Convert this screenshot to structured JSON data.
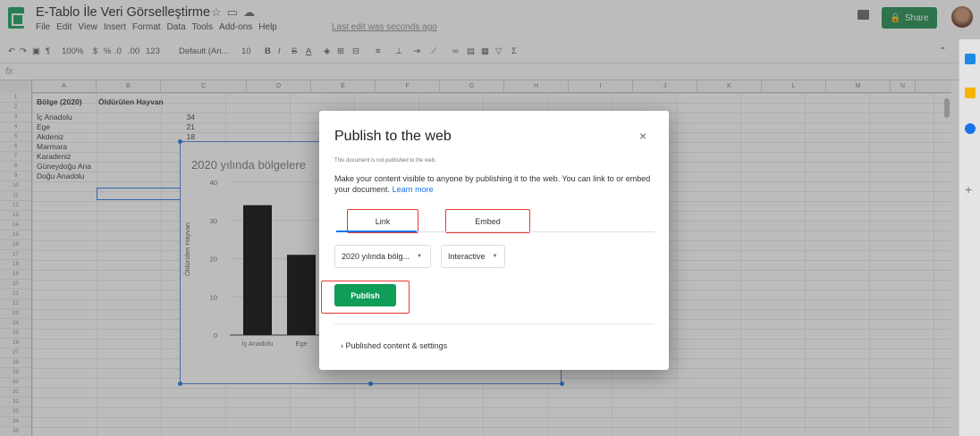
{
  "header": {
    "title": "E-Tablo İle Veri Görselleştirme",
    "title_icons": [
      "star-icon",
      "folder-icon",
      "cloud-icon"
    ],
    "menu": [
      "File",
      "Edit",
      "View",
      "Insert",
      "Format",
      "Data",
      "Tools",
      "Add-ons",
      "Help"
    ],
    "last_edit": "Last edit was seconds ago",
    "share_label": "Share"
  },
  "toolbar": {
    "zoom": "100%",
    "currency": "$",
    "percent": "%",
    "decimals_less": ".0",
    "decimals_more": ".00",
    "format_more": "123",
    "font": "Default (Ari...",
    "font_size": "10"
  },
  "formula_bar": {
    "fx": "fx"
  },
  "columns": [
    "A",
    "B",
    "C",
    "D",
    "E",
    "F",
    "G",
    "H",
    "I",
    "J",
    "K",
    "L",
    "M",
    "N"
  ],
  "rows": [
    "1",
    "2",
    "3",
    "4",
    "5",
    "6",
    "7",
    "8",
    "9",
    "10",
    "11",
    "12",
    "13",
    "14",
    "15",
    "16",
    "17",
    "18",
    "19",
    "20",
    "21",
    "22",
    "23",
    "24",
    "25",
    "26",
    "27",
    "28",
    "29",
    "30",
    "31",
    "32",
    "33",
    "34",
    "35"
  ],
  "sheet": {
    "header_a": "Bölge (2020)",
    "header_b": "Öldürülen Hayvan",
    "regions": [
      "İç Anadolu",
      "Ege",
      "Akdeniz",
      "Marmara",
      "Karadeniz",
      "Güneydoğu Ana",
      "Doğu Anadolu"
    ],
    "values": [
      "34",
      "21",
      "18"
    ]
  },
  "embedded_chart": {
    "title": "2020 yılında bölgelere",
    "ylabel": "Öldürülen Hayvan",
    "yticks": [
      "0",
      "10",
      "20",
      "30",
      "40"
    ],
    "xticks": [
      "İç Anadolu",
      "Ege"
    ]
  },
  "chart_data": {
    "type": "bar",
    "title": "2020 yılında bölgelere",
    "categories": [
      "İç Anadolu",
      "Ege",
      "Akdeniz"
    ],
    "values": [
      34,
      21,
      18
    ],
    "ylabel": "Öldürülen Hayvan",
    "ylim": [
      0,
      40
    ],
    "grid": true
  },
  "dialog": {
    "title": "Publish to the web",
    "close": "×",
    "note": "This document is not published to the web.",
    "description": "Make your content visible to anyone by publishing it to the web. You can link to or embed your document.",
    "learn_more": "Learn more",
    "tab_link": "Link",
    "tab_embed": "Embed",
    "dropdown_chart": "2020 yılında bölg...",
    "dropdown_format": "Interactive",
    "publish_label": "Publish",
    "published_settings": "Published content & settings"
  },
  "colors": {
    "brand_green": "#0f9d58",
    "accent_blue": "#1a73e8",
    "highlight_red": "#e53935"
  }
}
